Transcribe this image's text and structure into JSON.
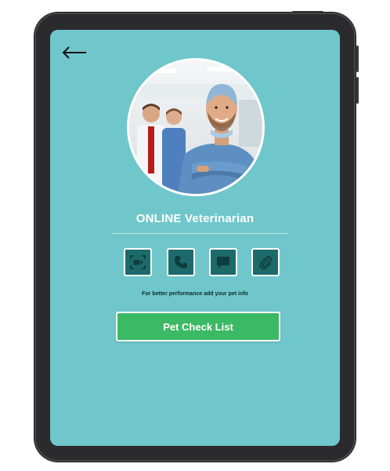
{
  "header": {
    "back_icon": "arrow-left-icon"
  },
  "profile": {
    "title": "ONLINE Veterinarian",
    "image_icon": "doctor-photo"
  },
  "actions": [
    {
      "name": "video-call",
      "icon": "video-camera-icon"
    },
    {
      "name": "phone-call",
      "icon": "phone-icon"
    },
    {
      "name": "chat",
      "icon": "chat-bubble-icon"
    },
    {
      "name": "attach",
      "icon": "paperclip-icon"
    }
  ],
  "hint_text": "For better performance add your pet info",
  "primary_button": {
    "label": "Pet Check List"
  },
  "colors": {
    "screen_bg": "#6fc7cb",
    "action_bg": "#1d6a6b",
    "primary": "#3cb964",
    "frame": "#2b2b2d"
  }
}
